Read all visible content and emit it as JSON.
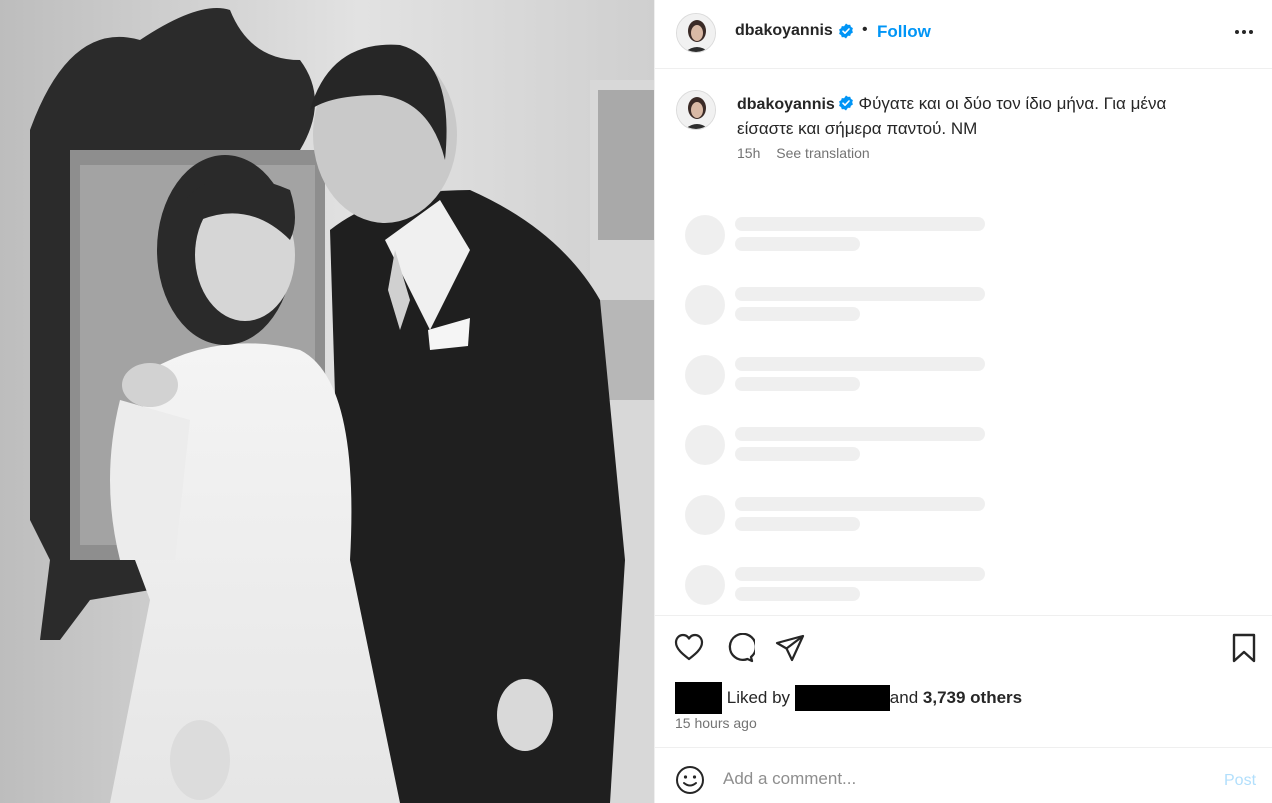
{
  "post": {
    "photo_description_icon": "photo",
    "author": {
      "username": "dbakoyannis",
      "verified": true
    },
    "follow_label": "Follow",
    "dot": "•",
    "caption": {
      "username": "dbakoyannis",
      "text": "Φύγατε και οι δύο τον ίδιο μήνα. Για μένα είσαστε και σήμερα παντού. ΝΜ",
      "time": "15h",
      "see_translation": "See translation"
    },
    "likes": {
      "prefix": "Liked by",
      "and": "and",
      "others": "3,739 others"
    },
    "time_ago": "15 hours ago",
    "comment_placeholder": "Add a comment...",
    "post_label": "Post",
    "colors": {
      "accent": "#0095f6",
      "verified": "#0095f6",
      "muted": "#737373",
      "post_disabled": "#b2dffc"
    },
    "icons": [
      "more-icon",
      "verified-icon",
      "heart-icon",
      "comment-icon",
      "share-icon",
      "bookmark-icon",
      "emoji-icon"
    ]
  }
}
